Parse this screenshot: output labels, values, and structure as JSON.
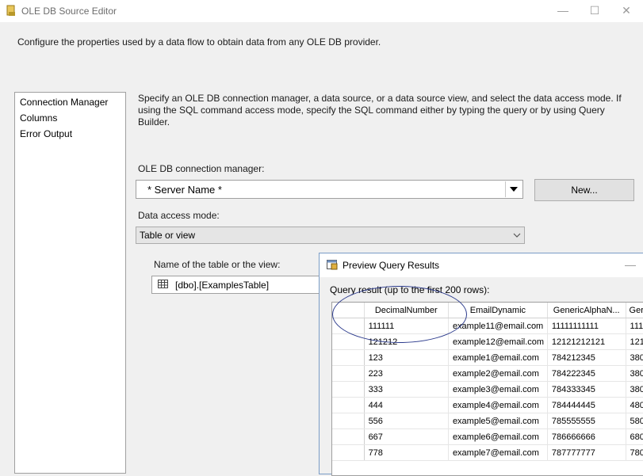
{
  "window": {
    "title": "OLE DB Source Editor",
    "description": "Configure the properties used by a data flow to obtain data from any OLE DB provider."
  },
  "nav": {
    "items": [
      {
        "label": "Connection Manager"
      },
      {
        "label": "Columns"
      },
      {
        "label": "Error Output"
      }
    ]
  },
  "main": {
    "instructions": "Specify an OLE DB connection manager, a data source, or a data source view, and select the data access mode. If using the SQL command access mode, specify the SQL command either by typing the query or by using Query Builder.",
    "connection_label": "OLE DB connection manager:",
    "connection_value": "* Server Name *",
    "new_button": "New...",
    "access_mode_label": "Data access mode:",
    "access_mode_value": "Table or view",
    "table_label": "Name of the table or the view:",
    "table_value": "[dbo].[ExamplesTable]"
  },
  "preview": {
    "title": "Preview Query Results",
    "query_label": "Query result (up to the first 200 rows):",
    "columns": [
      "DecimalNumber",
      "EmailDynamic",
      "GenericAlphaN...",
      "Ger"
    ],
    "rows": [
      [
        "111111",
        "example11@email.com",
        "11111111111",
        "111"
      ],
      [
        "121212",
        "example12@email.com",
        "12121212121",
        "121"
      ],
      [
        "123",
        "example1@email.com",
        "784212345",
        "380"
      ],
      [
        "223",
        "example2@email.com",
        "784222345",
        "380"
      ],
      [
        "333",
        "example3@email.com",
        "784333345",
        "380"
      ],
      [
        "444",
        "example4@email.com",
        "784444445",
        "480"
      ],
      [
        "556",
        "example5@email.com",
        "785555555",
        "580"
      ],
      [
        "667",
        "example6@email.com",
        "786666666",
        "680"
      ],
      [
        "778",
        "example7@email.com",
        "787777777",
        "780"
      ]
    ]
  },
  "colors": {
    "dialog_border": "#7a9cc6",
    "annotation_ellipse": "#2b3a8c",
    "background": "#f0f0f0"
  }
}
